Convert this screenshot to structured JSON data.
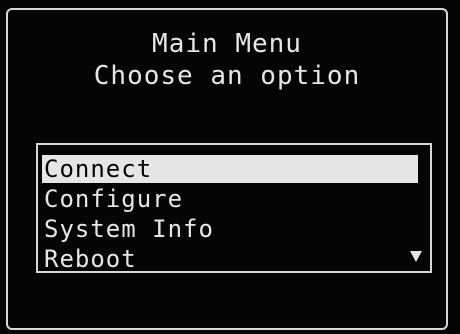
{
  "header": {
    "title": "Main Menu",
    "subtitle": "Choose an option"
  },
  "menu": {
    "items": [
      {
        "label": "Connect",
        "selected": true
      },
      {
        "label": "Configure",
        "selected": false
      },
      {
        "label": "System Info",
        "selected": false
      },
      {
        "label": "Reboot",
        "selected": false
      }
    ],
    "scroll_icon": "scroll-down-arrow-icon"
  },
  "colors": {
    "background": "#050505",
    "foreground": "#e6e6e6",
    "border": "#d8d8d8"
  }
}
